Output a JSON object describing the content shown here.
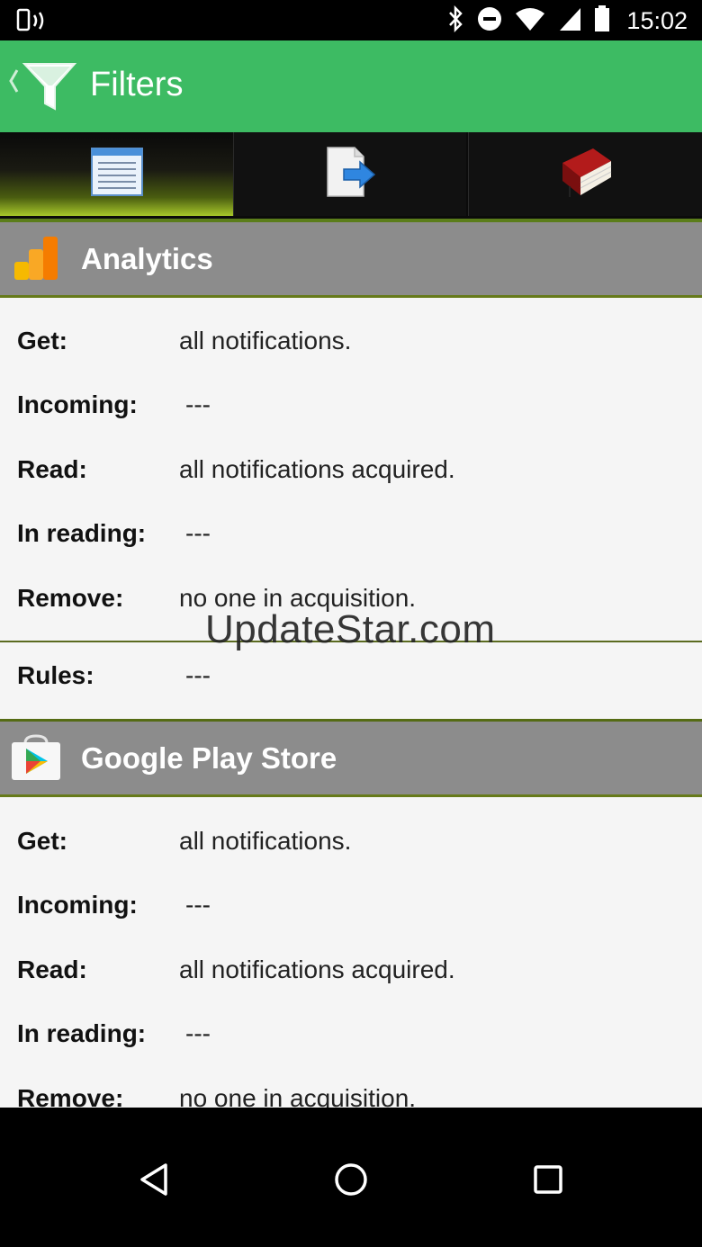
{
  "status_bar": {
    "time": "15:02",
    "icons": [
      "vibrate-icon",
      "bluetooth-icon",
      "dnd-icon",
      "wifi-icon",
      "signal-icon",
      "battery-icon"
    ]
  },
  "app_bar": {
    "title": "Filters",
    "icon": "filter-icon",
    "color": "#3dbb63"
  },
  "tabs": [
    {
      "icon": "list-icon",
      "active": true
    },
    {
      "icon": "export-icon",
      "active": false
    },
    {
      "icon": "book-icon",
      "active": false
    }
  ],
  "sections": [
    {
      "name": "Analytics",
      "icon": "analytics-app-icon",
      "rows": [
        {
          "label": "Get:",
          "value": "all notifications."
        },
        {
          "label": "Incoming:",
          "value": "---"
        },
        {
          "label": "Read:",
          "value": "all notifications acquired."
        },
        {
          "label": "In reading:",
          "value": "---"
        },
        {
          "label": "Remove:",
          "value": "no one in acquisition."
        },
        {
          "label": "Rules:",
          "value": "---"
        }
      ]
    },
    {
      "name": "Google Play Store",
      "icon": "play-store-app-icon",
      "rows": [
        {
          "label": "Get:",
          "value": "all notifications."
        },
        {
          "label": "Incoming:",
          "value": "---"
        },
        {
          "label": "Read:",
          "value": "all notifications acquired."
        },
        {
          "label": "In reading:",
          "value": "---"
        },
        {
          "label": "Remove:",
          "value": "no one in acquisition."
        }
      ]
    }
  ],
  "watermark": "UpdateStar.com",
  "nav_bar": {
    "buttons": [
      "back-icon",
      "home-icon",
      "recents-icon"
    ]
  }
}
